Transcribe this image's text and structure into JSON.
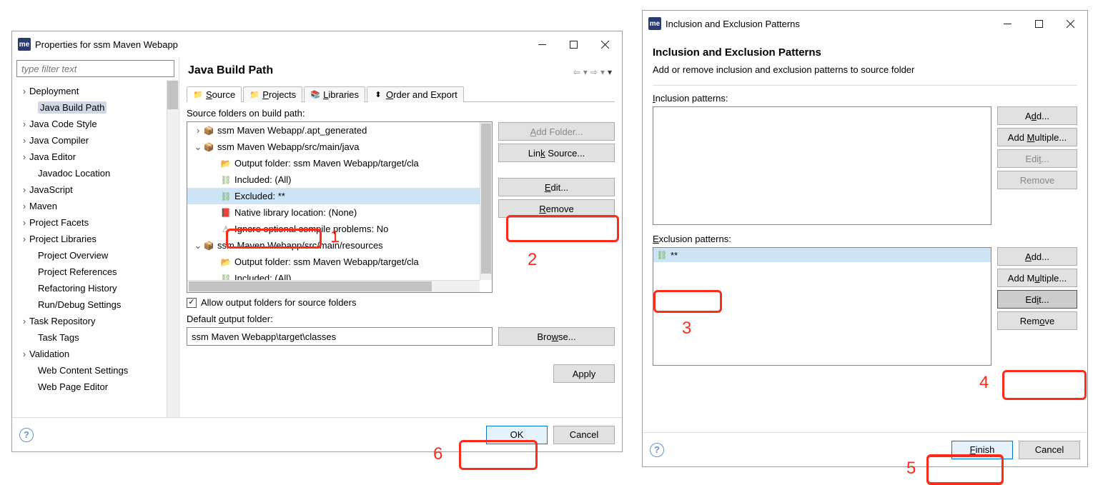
{
  "win1": {
    "title": "Properties for ssm Maven Webapp",
    "filter_placeholder": "type filter text",
    "tree": [
      {
        "label": "Deployment",
        "exp": true,
        "indent": 0
      },
      {
        "label": "Java Build Path",
        "exp": false,
        "indent": 1,
        "selected": true
      },
      {
        "label": "Java Code Style",
        "exp": true,
        "indent": 0
      },
      {
        "label": "Java Compiler",
        "exp": true,
        "indent": 0
      },
      {
        "label": "Java Editor",
        "exp": true,
        "indent": 0
      },
      {
        "label": "Javadoc Location",
        "exp": false,
        "indent": 1
      },
      {
        "label": "JavaScript",
        "exp": true,
        "indent": 0
      },
      {
        "label": "Maven",
        "exp": true,
        "indent": 0
      },
      {
        "label": "Project Facets",
        "exp": true,
        "indent": 0
      },
      {
        "label": "Project Libraries",
        "exp": true,
        "indent": 0
      },
      {
        "label": "Project Overview",
        "exp": false,
        "indent": 1
      },
      {
        "label": "Project References",
        "exp": false,
        "indent": 1
      },
      {
        "label": "Refactoring History",
        "exp": false,
        "indent": 1
      },
      {
        "label": "Run/Debug Settings",
        "exp": false,
        "indent": 1
      },
      {
        "label": "Task Repository",
        "exp": true,
        "indent": 0
      },
      {
        "label": "Task Tags",
        "exp": false,
        "indent": 1
      },
      {
        "label": "Validation",
        "exp": true,
        "indent": 0
      },
      {
        "label": "Web Content Settings",
        "exp": false,
        "indent": 1
      },
      {
        "label": "Web Page Editor",
        "exp": false,
        "indent": 1
      }
    ],
    "page_title": "Java Build Path",
    "tabs": {
      "source": "Source",
      "projects": "Projects",
      "libraries": "Libraries",
      "order": "Order and Export"
    },
    "source_label": "Source folders on build path:",
    "source_tree": [
      {
        "t": "pkg",
        "d": 0,
        "chev": ">",
        "text": "ssm Maven Webapp/.apt_generated"
      },
      {
        "t": "pkg",
        "d": 0,
        "chev": "v",
        "text": "ssm Maven Webapp/src/main/java"
      },
      {
        "t": "out",
        "d": 1,
        "text": "Output folder: ssm Maven Webapp/target/cla"
      },
      {
        "t": "filt",
        "d": 1,
        "text": "Included: (All)"
      },
      {
        "t": "filt",
        "d": 1,
        "text": "Excluded: **",
        "sel": true
      },
      {
        "t": "lib",
        "d": 1,
        "text": "Native library location: (None)"
      },
      {
        "t": "warn",
        "d": 1,
        "text": "Ignore optional compile problems: No"
      },
      {
        "t": "pkg",
        "d": 0,
        "chev": "v",
        "text": "ssm Maven Webapp/src/main/resources"
      },
      {
        "t": "out",
        "d": 1,
        "text": "Output folder: ssm Maven Webapp/target/cla"
      },
      {
        "t": "filt",
        "d": 1,
        "text": "Included: (All)"
      }
    ],
    "buttons": {
      "add_folder": "Add Folder...",
      "link_source": "Link Source...",
      "edit": "Edit...",
      "remove": "Remove"
    },
    "allow_checkbox": "Allow output folders for source folders",
    "default_label": "Default output folder:",
    "default_value": "ssm Maven Webapp\\target\\classes",
    "browse": "Browse...",
    "apply": "Apply",
    "ok": "OK",
    "cancel": "Cancel"
  },
  "win2": {
    "title": "Inclusion and Exclusion Patterns",
    "heading": "Inclusion and Exclusion Patterns",
    "sub": "Add or remove inclusion and exclusion patterns to source folder",
    "incl_label": "Inclusion patterns:",
    "excl_label": "Exclusion patterns:",
    "excl_item": "**",
    "buttons": {
      "add": "Add...",
      "add_multiple": "Add Multiple...",
      "edit": "Edit...",
      "remove": "Remove"
    },
    "finish": "Finish",
    "cancel": "Cancel"
  },
  "annotations": {
    "n1": "1",
    "n2": "2",
    "n3": "3",
    "n4": "4",
    "n5": "5",
    "n6": "6"
  }
}
